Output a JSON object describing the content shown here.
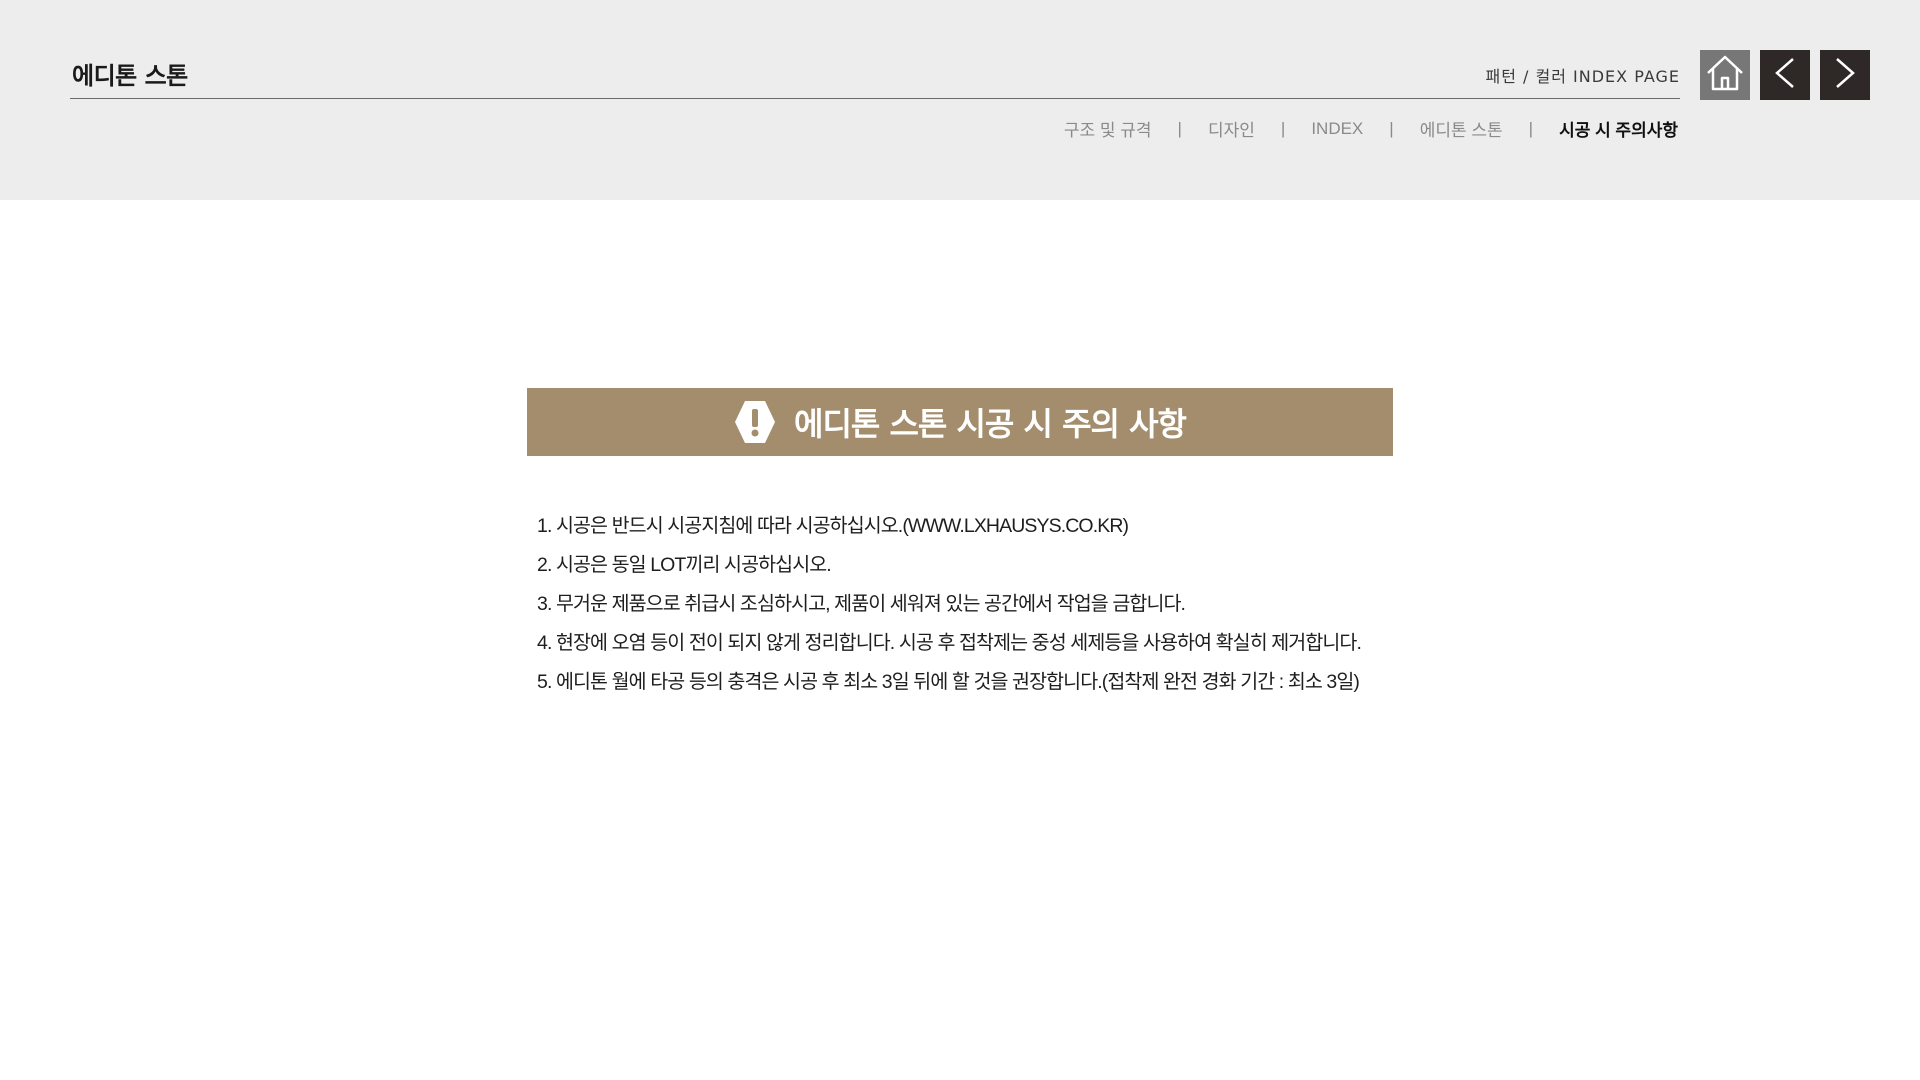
{
  "header": {
    "brand_title": "에디톤 스톤",
    "index_label": "패턴 / 컬러 INDEX PAGE",
    "nav": {
      "home_icon": "home-icon",
      "prev_icon": "chevron-left-icon",
      "next_icon": "chevron-right-icon"
    }
  },
  "breadcrumb": {
    "separator": "|",
    "items": [
      {
        "label": "구조 및 규격"
      },
      {
        "label": "디자인"
      },
      {
        "label": "INDEX"
      },
      {
        "label": "에디톤 스톤"
      },
      {
        "label": "시공 시 주의사항"
      }
    ]
  },
  "main": {
    "banner": {
      "icon": "warning-hexagon-icon",
      "title": "에디톤 스톤 시공 시 주의 사항"
    },
    "notes": [
      "1. 시공은 반드시 시공지침에 따라 시공하십시오.(WWW.LXHAUSYS.CO.KR)",
      "2. 시공은 동일 LOT끼리 시공하십시오.",
      "3. 무거운 제품으로 취급시 조심하시고, 제품이 세워져 있는 공간에서 작업을 금합니다.",
      "4. 현장에 오염 등이 전이 되지 않게 정리합니다. 시공 후 접착제는 중성 세제등을 사용하여 확실히 제거합니다.",
      "5. 에디톤 월에 타공 등의 충격은 시공 후 최소 3일 뒤에 할 것을 권장합니다.(접착제 완전 경화 기간 : 최소 3일)"
    ]
  },
  "colors": {
    "header_bg": "#ededed",
    "banner_bg": "#a38d6c",
    "home_button_bg": "#777777",
    "arrow_button_bg": "#2e2927"
  }
}
